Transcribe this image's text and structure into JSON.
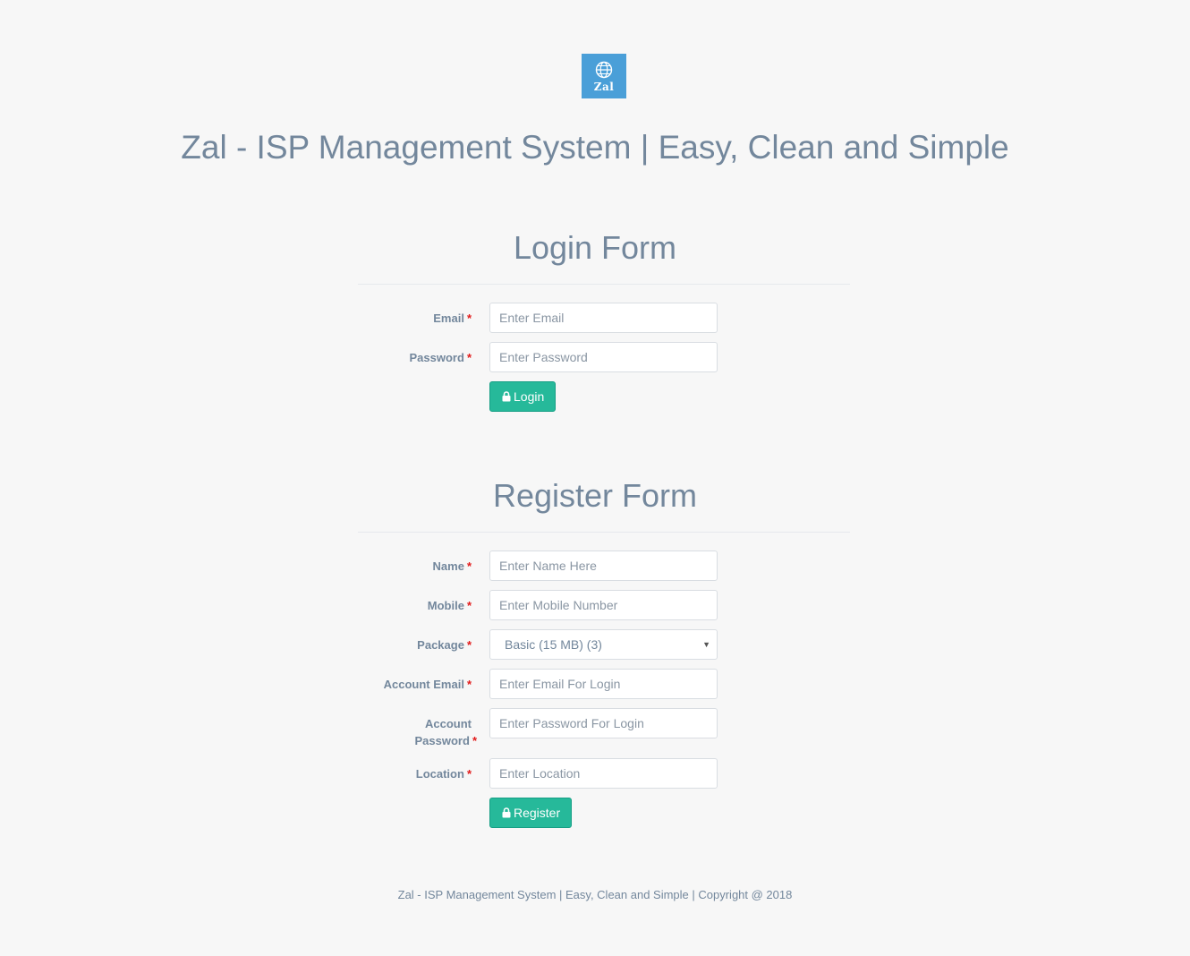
{
  "logo": {
    "text": "Zal",
    "icon": "globe-icon",
    "color": "#4a9fd8"
  },
  "site_title": "Zal - ISP Management System | Easy, Clean and Simple",
  "login": {
    "title": "Login Form",
    "email_label": "Email",
    "email_placeholder": "Enter Email",
    "password_label": "Password",
    "password_placeholder": "Enter Password",
    "button_label": "Login",
    "button_icon": "lock-icon"
  },
  "register": {
    "title": "Register Form",
    "name_label": "Name",
    "name_placeholder": "Enter Name Here",
    "mobile_label": "Mobile",
    "mobile_placeholder": "Enter Mobile Number",
    "package_label": "Package",
    "package_value": "Basic (15 MB) (3)",
    "account_email_label": "Account Email",
    "account_email_placeholder": "Enter Email For Login",
    "account_password_label_line1": "Account",
    "account_password_label_line2": "Password",
    "account_password_placeholder": "Enter Password For Login",
    "location_label": "Location",
    "location_placeholder": "Enter Location",
    "button_label": "Register",
    "button_icon": "lock-icon"
  },
  "required_marker": "*",
  "footer": "Zal - ISP Management System | Easy, Clean and Simple | Copyright @ 2018",
  "colors": {
    "background": "#f7f7f7",
    "text": "#73879c",
    "button": "#26b99a",
    "required": "#e21a1a"
  }
}
